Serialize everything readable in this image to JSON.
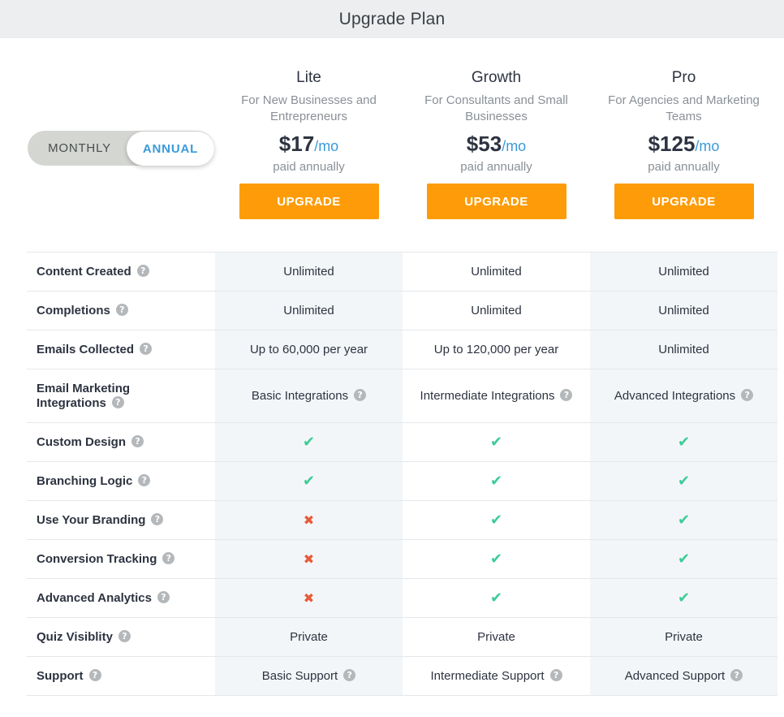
{
  "header": {
    "title": "Upgrade Plan"
  },
  "billing_toggle": {
    "monthly_label": "MONTHLY",
    "annual_label": "ANNUAL",
    "selected": "ANNUAL"
  },
  "plans": [
    {
      "name": "Lite",
      "description": "For New Businesses and Entrepreneurs",
      "price": "$17",
      "per": "/mo",
      "billing": "paid annually",
      "button": "UPGRADE"
    },
    {
      "name": "Growth",
      "description": "For Consultants and Small Businesses",
      "price": "$53",
      "per": "/mo",
      "billing": "paid annually",
      "button": "UPGRADE"
    },
    {
      "name": "Pro",
      "description": "For Agencies and Marketing Teams",
      "price": "$125",
      "per": "/mo",
      "billing": "paid annually",
      "button": "UPGRADE"
    }
  ],
  "features": [
    {
      "label": "Content Created",
      "values": [
        {
          "type": "text",
          "text": "Unlimited"
        },
        {
          "type": "text",
          "text": "Unlimited"
        },
        {
          "type": "text",
          "text": "Unlimited"
        }
      ]
    },
    {
      "label": "Completions",
      "values": [
        {
          "type": "text",
          "text": "Unlimited"
        },
        {
          "type": "text",
          "text": "Unlimited"
        },
        {
          "type": "text",
          "text": "Unlimited"
        }
      ]
    },
    {
      "label": "Emails Collected",
      "values": [
        {
          "type": "text",
          "text": "Up to 60,000 per year"
        },
        {
          "type": "text",
          "text": "Up to 120,000 per year"
        },
        {
          "type": "text",
          "text": "Unlimited"
        }
      ]
    },
    {
      "label": "Email Marketing Integrations",
      "values": [
        {
          "type": "text",
          "text": "Basic Integrations",
          "help": true
        },
        {
          "type": "text",
          "text": "Intermediate Integrations",
          "help": true
        },
        {
          "type": "text",
          "text": "Advanced Integrations",
          "help": true
        }
      ]
    },
    {
      "label": "Custom Design",
      "values": [
        {
          "type": "check"
        },
        {
          "type": "check"
        },
        {
          "type": "check"
        }
      ]
    },
    {
      "label": "Branching Logic",
      "values": [
        {
          "type": "check"
        },
        {
          "type": "check"
        },
        {
          "type": "check"
        }
      ]
    },
    {
      "label": "Use Your Branding",
      "values": [
        {
          "type": "cross"
        },
        {
          "type": "check"
        },
        {
          "type": "check"
        }
      ]
    },
    {
      "label": "Conversion Tracking",
      "values": [
        {
          "type": "cross"
        },
        {
          "type": "check"
        },
        {
          "type": "check"
        }
      ]
    },
    {
      "label": "Advanced Analytics",
      "values": [
        {
          "type": "cross"
        },
        {
          "type": "check"
        },
        {
          "type": "check"
        }
      ]
    },
    {
      "label": "Quiz Visiblity",
      "values": [
        {
          "type": "text",
          "text": "Private"
        },
        {
          "type": "text",
          "text": "Private"
        },
        {
          "type": "text",
          "text": "Private"
        }
      ]
    },
    {
      "label": "Support",
      "values": [
        {
          "type": "text",
          "text": "Basic Support",
          "help": true
        },
        {
          "type": "text",
          "text": "Intermediate Support",
          "help": true
        },
        {
          "type": "text",
          "text": "Advanced Support",
          "help": true
        }
      ]
    }
  ],
  "icons": {
    "help": "question-circle-icon",
    "check": "check-icon",
    "cross": "cross-icon",
    "help_glyph": "?",
    "check_glyph": "✔",
    "cross_glyph": "✖"
  },
  "colors": {
    "accent": "#3a9ad9",
    "button": "#fd9c08",
    "check": "#3dcc96",
    "cross": "#e85a38"
  }
}
